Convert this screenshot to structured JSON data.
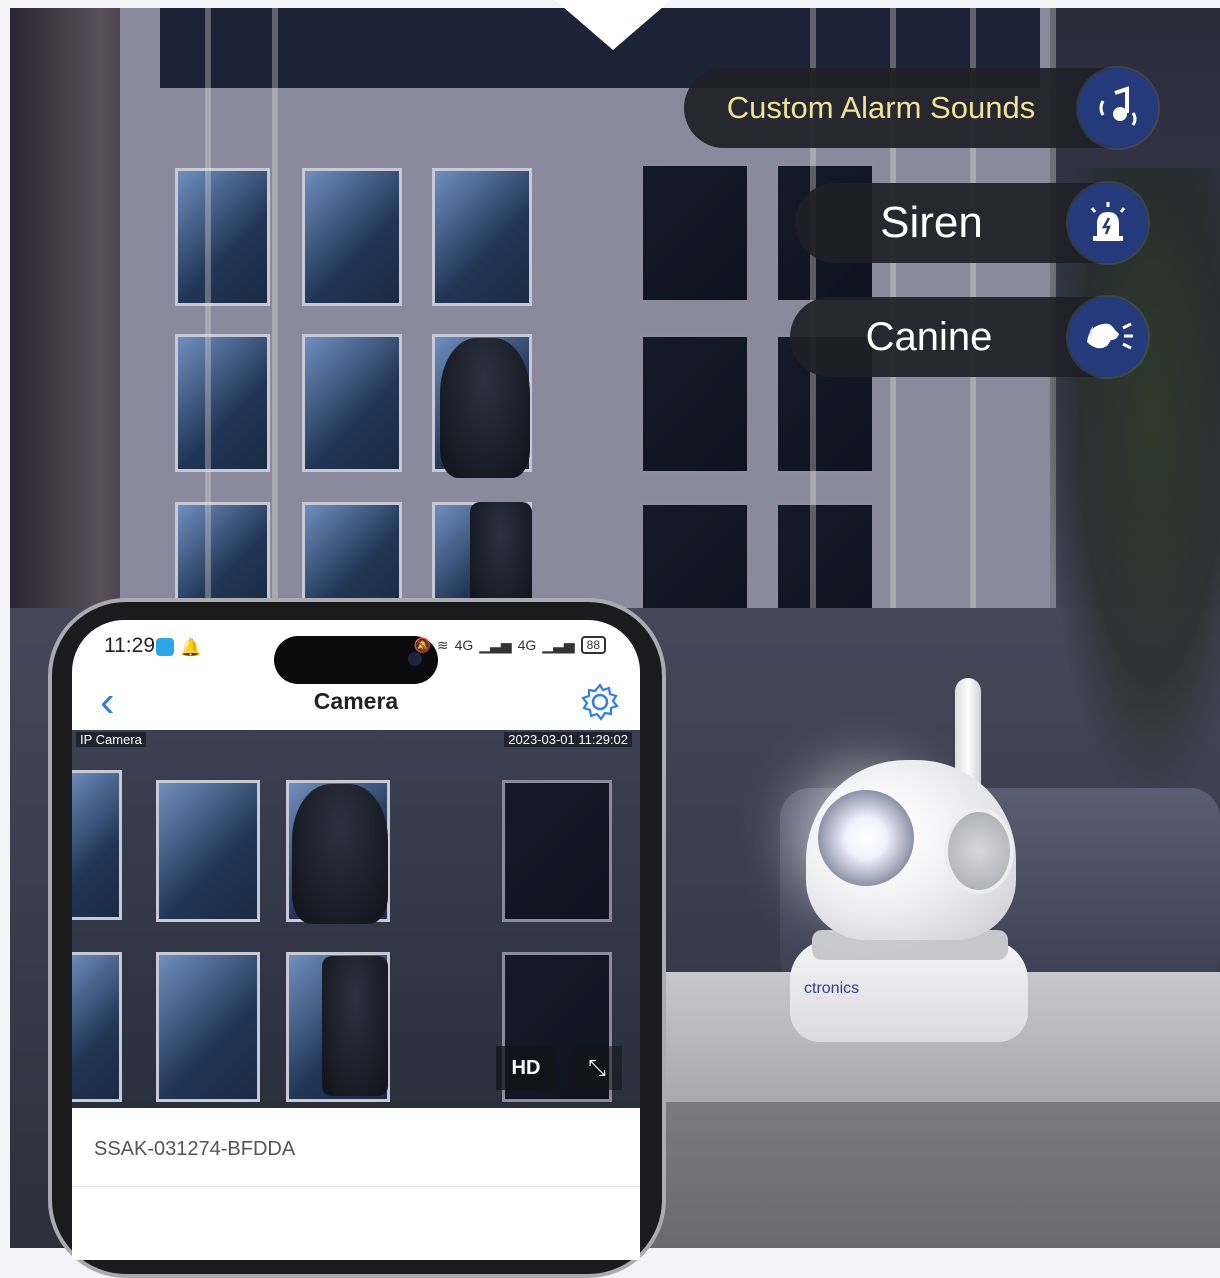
{
  "overlay": {
    "pills": [
      {
        "label": "Custom Alarm Sounds",
        "icon": "music-note-sound-icon"
      },
      {
        "label": "Siren",
        "icon": "siren-alarm-icon"
      },
      {
        "label": "Canine",
        "icon": "dog-bark-icon"
      }
    ]
  },
  "camera_device": {
    "brand": "ctronics"
  },
  "phone": {
    "status_bar": {
      "time": "11:29",
      "network_1": "4G",
      "network_2": "4G",
      "battery": "88"
    },
    "nav": {
      "title": "Camera",
      "back_icon": "chevron-left-icon",
      "settings_icon": "gear-icon"
    },
    "feed": {
      "label": "IP Camera",
      "timestamp": "2023-03-01 11:29:02",
      "hd_label": "HD",
      "expand_icon": "expand-arrow-icon"
    },
    "device_id": "SSAK-031274-BFDDA"
  },
  "colors": {
    "pill_bg": "#1e2026",
    "pill_icon_bg": "#243a7a",
    "accent_text": "#efe39a",
    "ios_blue": "#2f7ee6"
  }
}
